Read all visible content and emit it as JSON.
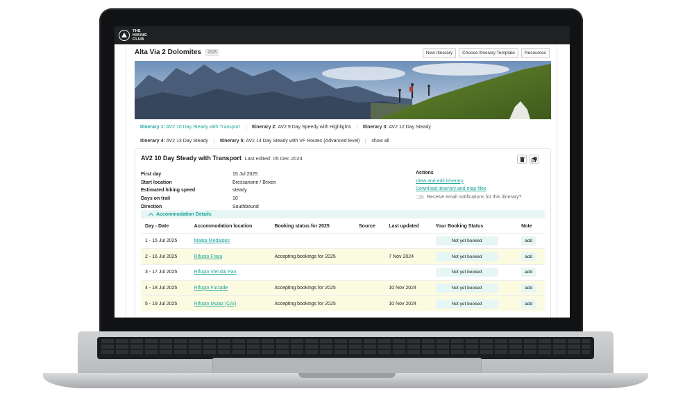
{
  "app": {
    "logo_text": "THE\nHIKING\nCLUB"
  },
  "header": {
    "title": "Alta Via 2 Dolomites",
    "year_badge": "2025",
    "buttons": {
      "new_itinerary": "New Itinerary",
      "choose_template": "Choose Itinerary Template",
      "resources": "Resources"
    }
  },
  "tabs": [
    {
      "prefix": "Itinerary 1:",
      "label": "AV2 10 Day Steady with Transport",
      "active": true
    },
    {
      "prefix": "Itinerary 2:",
      "label": "AV2 9 Day Speedy with Highlights",
      "active": false
    },
    {
      "prefix": "Itinerary 3:",
      "label": "AV2 12 Day Steady",
      "active": false
    },
    {
      "prefix": "Itinerary 4:",
      "label": "AV2 13 Day Steady",
      "active": false
    },
    {
      "prefix": "Itinerary 5:",
      "label": "AV2 14 Day Steady with VF Routes (Advanced level)",
      "active": false
    }
  ],
  "show_all": "show all",
  "itinerary": {
    "title": "AV2 10 Day Steady with Transport",
    "last_edited": "Last edited: 05 Dec 2024",
    "details": [
      {
        "label": "First day",
        "value": "15 Jul 2025"
      },
      {
        "label": "Start location",
        "value": "Bressanone / Brixen"
      },
      {
        "label": "Estimated hiking speed",
        "value": "steady"
      },
      {
        "label": "Days on trail",
        "value": "10"
      },
      {
        "label": "Direction",
        "value": "Southbound"
      }
    ],
    "actions": {
      "heading": "Actions",
      "view_edit": "View and edit itinerary",
      "download": "Download itinerary and map files",
      "notify": "Receive email notifications for this itinerary?"
    }
  },
  "accommodation": {
    "section_title": "Accommodation Details",
    "columns": [
      "Day - Date",
      "Accommodation location",
      "Booking status for 2025",
      "Source",
      "Last updated",
      "Your Booking Status",
      "Note"
    ],
    "rows": [
      {
        "day": "1 - 15 Jul 2025",
        "location": "Malga Medalges",
        "booking": "",
        "source": "",
        "updated": "",
        "status": "Not yet booked",
        "note": "add",
        "highlight": false
      },
      {
        "day": "2 - 16 Jul 2025",
        "location": "Rifugio Frara",
        "booking": "Accepting bookings for 2025",
        "source": "",
        "updated": "7 Nov 2024",
        "status": "Not yet booked",
        "note": "add",
        "highlight": true
      },
      {
        "day": "3 - 17 Jul 2025",
        "location": "Rifugio Viel dal Pan",
        "booking": "",
        "source": "",
        "updated": "",
        "status": "Not yet booked",
        "note": "add",
        "highlight": false
      },
      {
        "day": "4 - 18 Jul 2025",
        "location": "Rifugio Fuciade",
        "booking": "Accepting bookings for 2025",
        "source": "",
        "updated": "10 Nov 2024",
        "status": "Not yet booked",
        "note": "add",
        "highlight": true
      },
      {
        "day": "5 - 19 Jul 2025",
        "location": "Rifugio Mulaz (CAI)",
        "booking": "Accepting bookings for 2025",
        "source": "",
        "updated": "10 Nov 2024",
        "status": "Not yet booked",
        "note": "add",
        "highlight": true
      }
    ]
  },
  "colors": {
    "accent": "#1aa39a",
    "highlight_row": "#fbfbe2",
    "pill_bg": "#e6f6f4"
  }
}
